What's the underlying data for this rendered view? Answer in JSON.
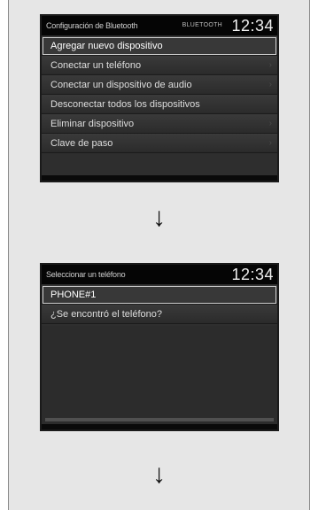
{
  "screen1": {
    "title": "Configuración de Bluetooth",
    "status": "BLUETOOTH",
    "clock": "12:34",
    "items": [
      {
        "label": "Agregar nuevo dispositivo"
      },
      {
        "label": "Conectar un teléfono"
      },
      {
        "label": "Conectar un dispositivo de audio"
      },
      {
        "label": "Desconectar todos los dispositivos"
      },
      {
        "label": "Eliminar dispositivo"
      },
      {
        "label": "Clave de paso"
      }
    ]
  },
  "screen2": {
    "title": "Seleccionar un teléfono",
    "clock": "12:34",
    "items": [
      {
        "label": "PHONE#1"
      },
      {
        "label": "¿Se encontró el teléfono?"
      }
    ]
  },
  "arrow_glyph": "↓",
  "chevron_glyph": "›",
  "colors": {
    "screen_bg": "#2e2e2e",
    "titlebar_bg": "#050505",
    "page_bg": "#e6e6e6"
  }
}
